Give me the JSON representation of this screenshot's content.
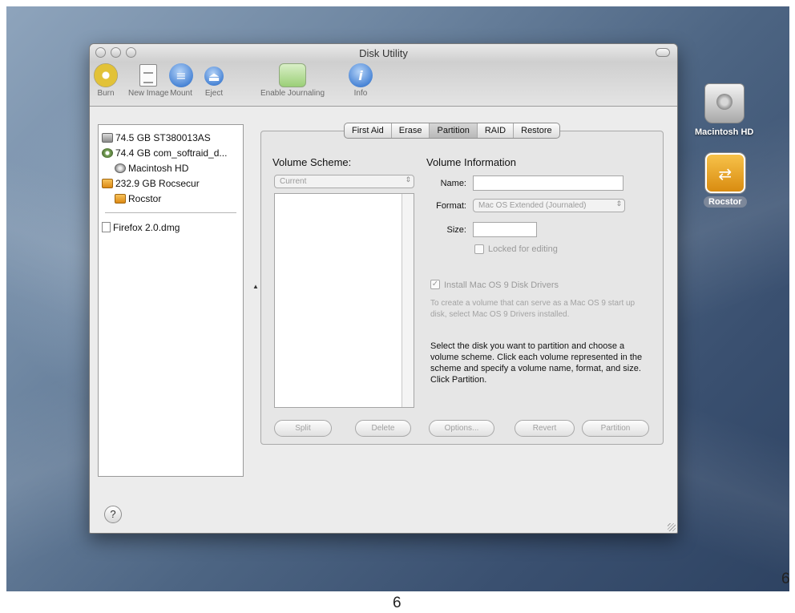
{
  "window": {
    "title": "Disk Utility"
  },
  "toolbar": {
    "burn": "Burn",
    "new_image": "New Image",
    "mount": "Mount",
    "eject": "Eject",
    "enable_journaling": "Enable Journaling",
    "info": "Info",
    "info_glyph": "i"
  },
  "sidebar": {
    "items": [
      {
        "label": "74.5 GB ST380013AS",
        "icon": "hard-drive-icon"
      },
      {
        "label": "74.4 GB com_softraid_d...",
        "icon": "disc-icon"
      },
      {
        "label": "Macintosh HD",
        "icon": "volume-icon"
      },
      {
        "label": "232.9 GB Rocsecur",
        "icon": "external-drive-icon"
      },
      {
        "label": "Rocstor",
        "icon": "external-volume-icon"
      }
    ],
    "images": [
      {
        "label": "Firefox 2.0.dmg",
        "icon": "disk-image-icon"
      }
    ]
  },
  "tabs": [
    "First Aid",
    "Erase",
    "Partition",
    "RAID",
    "Restore"
  ],
  "active_tab": "Partition",
  "partition": {
    "volume_scheme_label": "Volume Scheme:",
    "scheme_select_value": "Current",
    "volume_info_label": "Volume Information",
    "name_label": "Name:",
    "name_value": "",
    "format_label": "Format:",
    "format_value": "Mac OS Extended (Journaled)",
    "size_label": "Size:",
    "size_value": "",
    "locked_label": "Locked for editing",
    "locked_checked": false,
    "install_drivers_label": "Install Mac OS 9 Disk Drivers",
    "install_drivers_checked": true,
    "drivers_help": "To create a volume that can serve as a Mac OS 9 start up disk, select Mac OS 9 Drivers installed.",
    "instructions": "Select the disk you want to partition and choose a volume scheme. Click each volume represented in the scheme and specify a volume name, format, and size. Click Partition.",
    "buttons": {
      "split": "Split",
      "delete": "Delete",
      "options": "Options...",
      "revert": "Revert",
      "partition": "Partition"
    }
  },
  "help_button": "?",
  "desktop": {
    "icons": [
      {
        "label": "Macintosh HD",
        "icon": "internal-hard-drive-icon"
      },
      {
        "label": "Rocstor",
        "icon": "external-firewire-drive-icon"
      }
    ]
  },
  "page_numbers": {
    "bottom": "6",
    "right": "6"
  }
}
